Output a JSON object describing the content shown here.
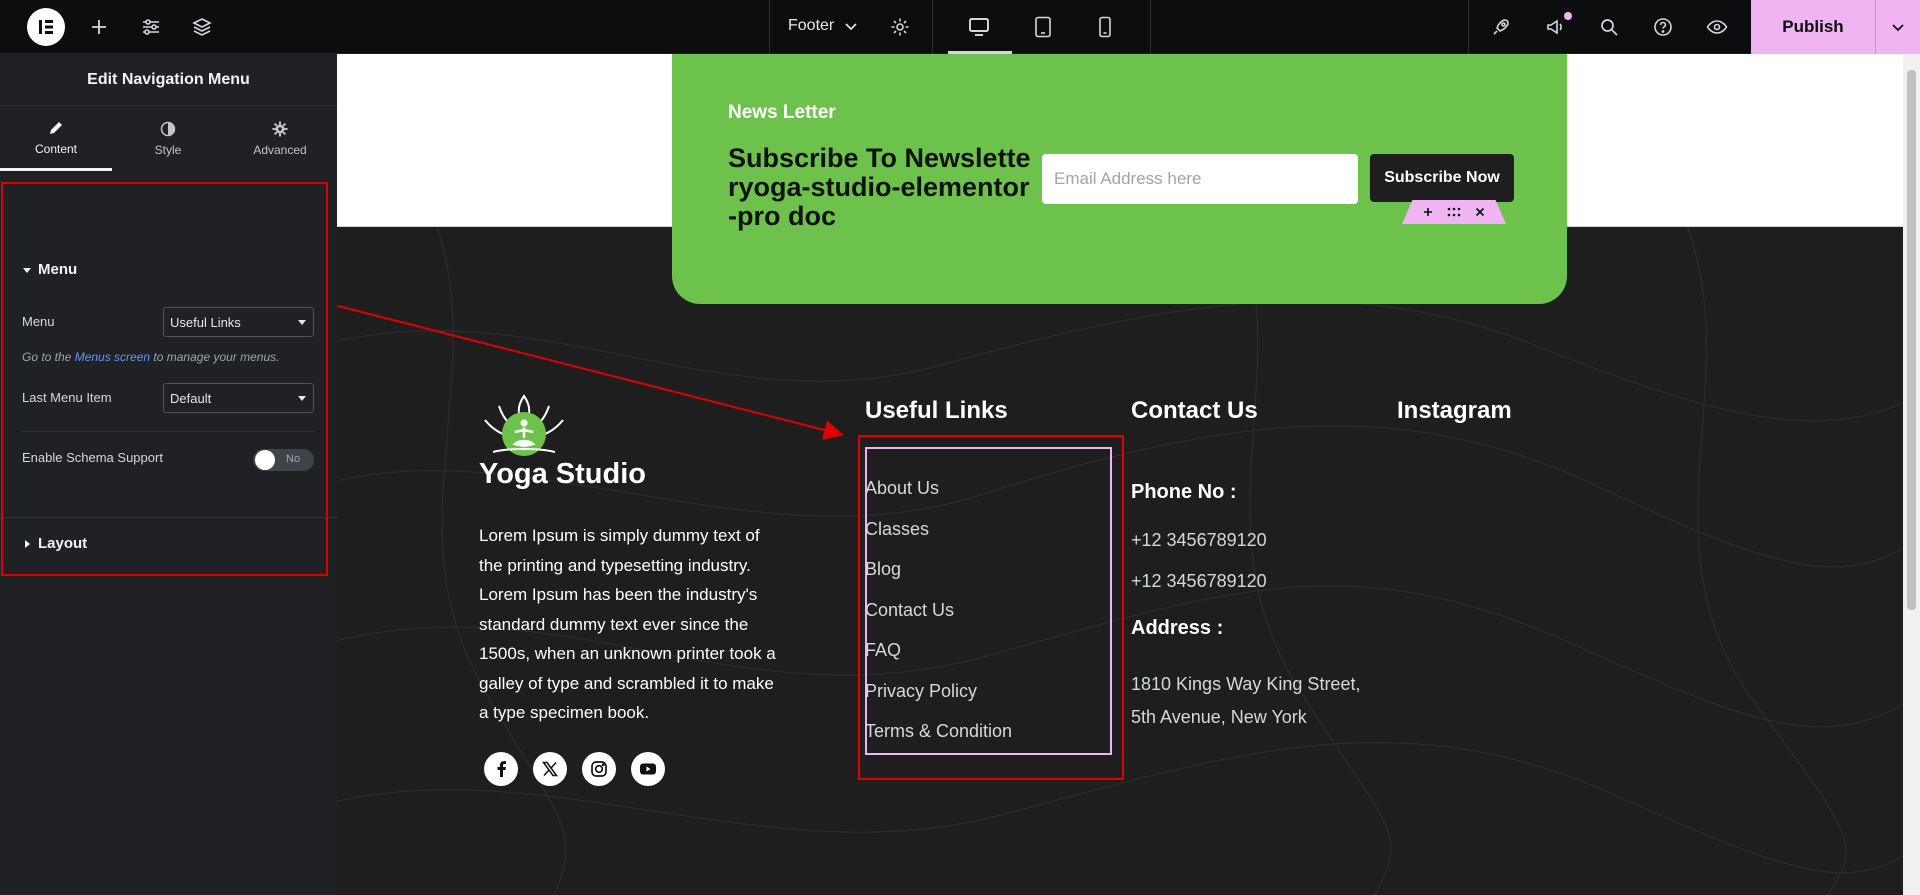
{
  "topbar": {
    "document_name": "Footer",
    "publish_label": "Publish"
  },
  "panel": {
    "title": "Edit Navigation Menu",
    "tabs": [
      {
        "label": "Content"
      },
      {
        "label": "Style"
      },
      {
        "label": "Advanced"
      }
    ],
    "menu_section": {
      "title": "Menu",
      "menu_label": "Menu",
      "menu_value": "Useful Links",
      "hint_before": "Go to the ",
      "hint_link": "Menus screen",
      "hint_after": " to manage your menus.",
      "last_item_label": "Last Menu Item",
      "last_item_value": "Default",
      "schema_label": "Enable Schema Support",
      "schema_toggle_text": "No"
    },
    "layout_section": {
      "title": "Layout"
    }
  },
  "newsletter": {
    "kicker": "News Letter",
    "title": "Subscribe To Newsletteryoga-studio-elementor-pro doc",
    "email_placeholder": "Email Address here",
    "button_label": "Subscribe Now"
  },
  "footer": {
    "brand": "Yoga Studio",
    "about": "Lorem Ipsum is simply dummy text of the printing and typesetting industry. Lorem Ipsum has been the industry's standard dummy text ever since the 1500s, when an unknown printer took a galley of type and scrambled it to make a type specimen book.",
    "useful_links_title": "Useful Links",
    "useful_links": [
      "About Us",
      "Classes",
      "Blog",
      "Contact Us",
      "FAQ",
      "Privacy Policy",
      "Terms & Condition"
    ],
    "contact_title": "Contact Us",
    "phone_label": "Phone No :",
    "phones": [
      "+12 3456789120",
      "+12 3456789120"
    ],
    "address_label": "Address :",
    "address_lines": [
      "1810 Kings Way King Street,",
      "5th Avenue, New York"
    ],
    "instagram_title": "Instagram",
    "socials": [
      "facebook-icon",
      "x-icon",
      "instagram-icon",
      "youtube-icon"
    ]
  },
  "colors": {
    "accent_pink": "#f0b4f3",
    "brand_green": "#6cc24a",
    "annotation_red": "#e00000"
  }
}
